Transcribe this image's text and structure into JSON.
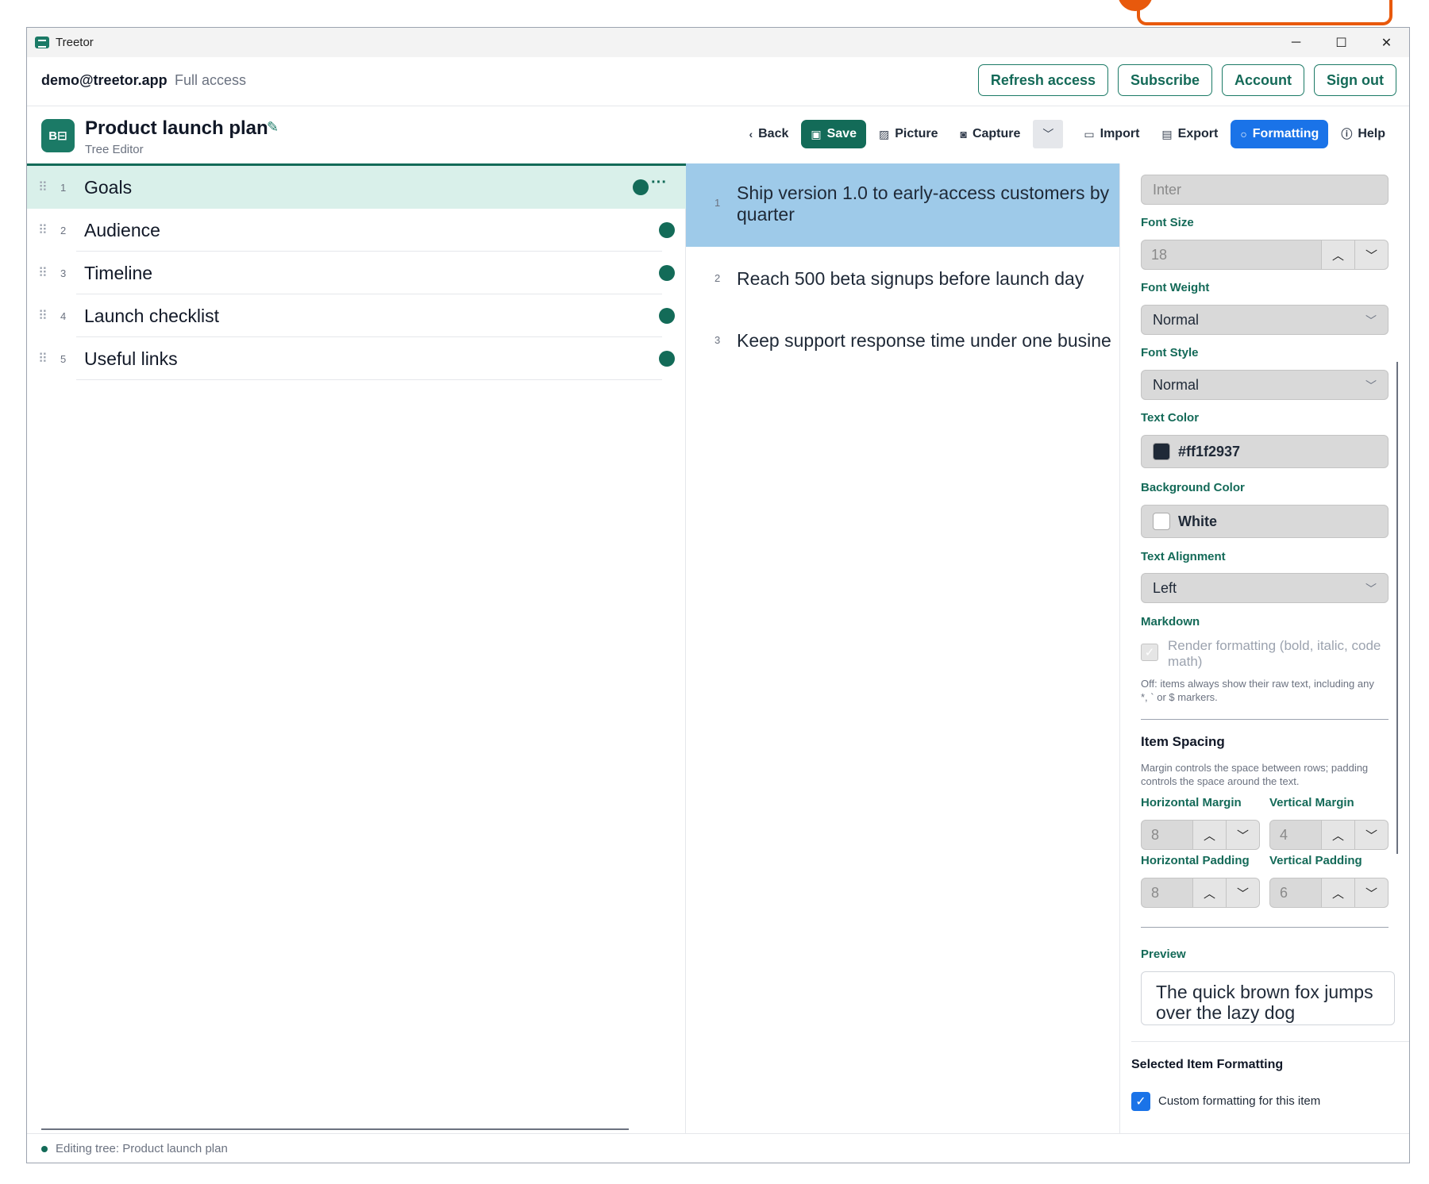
{
  "window": {
    "title": "Treetor",
    "controls": [
      "─",
      "☐",
      "✕"
    ]
  },
  "account": {
    "email": "demo@treetor.app",
    "access": "Full access",
    "buttons": [
      "Refresh access",
      "Subscribe",
      "Account",
      "Sign out"
    ]
  },
  "document": {
    "title": "Product launch plan",
    "subtitle": "Tree Editor",
    "icon_text": "B⊟"
  },
  "toolbar": {
    "back": "Back",
    "save": "Save",
    "picture": "Picture",
    "capture": "Capture",
    "import": "Import",
    "export": "Export",
    "formatting": "Formatting",
    "help": "Help"
  },
  "tree": {
    "selected_index": 0,
    "items": [
      {
        "num": "1",
        "label": "Goals"
      },
      {
        "num": "2",
        "label": "Audience"
      },
      {
        "num": "3",
        "label": "Timeline"
      },
      {
        "num": "4",
        "label": "Launch checklist"
      },
      {
        "num": "5",
        "label": "Useful links"
      }
    ]
  },
  "goals": {
    "items": [
      {
        "num": "1",
        "line1": "Ship version 1.0 to early-access customers by",
        "line2": "quarter"
      },
      {
        "num": "2",
        "line1": "Reach 500 beta signups before launch day",
        "line2": ""
      },
      {
        "num": "3",
        "line1": "Keep support response time under one busine",
        "line2": ""
      }
    ]
  },
  "formatting": {
    "font_family": "Inter",
    "font_size_label": "Font Size",
    "font_size": "18",
    "font_weight_label": "Font Weight",
    "font_weight": "Normal",
    "font_style_label": "Font Style",
    "font_style": "Normal",
    "text_color_label": "Text Color",
    "text_color": "#ff1f2937",
    "text_color_swatch": "#1f2937",
    "bg_color_label": "Background Color",
    "bg_color": "White",
    "bg_color_swatch": "#ffffff",
    "alignment_label": "Text Alignment",
    "alignment": "Left",
    "markdown_label": "Markdown",
    "markdown_option_1": "Render formatting (bold, italic, code",
    "markdown_option_2": "math)",
    "markdown_note_1": "Off: items always show their raw text, including any",
    "markdown_note_2": "*, ` or $ markers.",
    "spacing_title": "Item Spacing",
    "spacing_note_1": "Margin controls the space between rows; padding",
    "spacing_note_2": "controls the space around the text.",
    "h_margin_label": "Horizontal Margin",
    "h_margin": "8",
    "v_margin_label": "Vertical Margin",
    "v_margin": "4",
    "h_padding_label": "Horizontal Padding",
    "h_padding": "8",
    "v_padding_label": "Vertical Padding",
    "v_padding": "6",
    "preview_label": "Preview",
    "preview_line1": "The quick brown fox jumps",
    "preview_line2": "over the lazy dog",
    "selected_title": "Selected Item Formatting",
    "custom_label": "Custom formatting for this item",
    "custom_checked": true
  },
  "status": {
    "text": "Editing tree: Product launch plan"
  },
  "colors": {
    "accent": "#136b58",
    "blue": "#1a73e8",
    "selected_row": "#d9f0ea",
    "selected_goal": "#9ecae9"
  }
}
